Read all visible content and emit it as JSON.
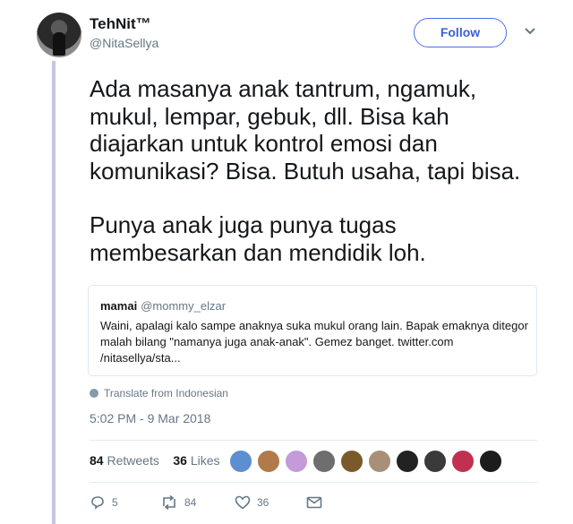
{
  "author": {
    "name": "TehNit™",
    "handle": "@NitaSellya"
  },
  "follow_label": "Follow",
  "tweet": {
    "paragraph1": "Ada masanya anak tantrum, ngamuk, mukul, lempar, gebuk, dll. Bisa kah diajarkan untuk kontrol emosi dan komunikasi? Bisa. Butuh usaha, tapi bisa.",
    "paragraph2": "Punya anak juga punya tugas membesarkan dan mendidik loh."
  },
  "quoted": {
    "name": "mamai",
    "handle": "@mommy_elzar",
    "text": "Waini, apalagi kalo sampe anaknya suka mukul orang lain. Bapak emaknya ditegor malah bilang \"namanya juga anak-anak\". Gemez banget. twitter.com /nitasellya/sta..."
  },
  "translate_label": "Translate from Indonesian",
  "timestamp": "5:02 PM - 9 Mar 2018",
  "stats": {
    "retweets": "84",
    "retweets_label": "Retweets",
    "likes": "36",
    "likes_label": "Likes"
  },
  "likers_colors": [
    "#5b8fd0",
    "#b07a4a",
    "#c59ad8",
    "#6e6e6e",
    "#7a5a2a",
    "#a89078",
    "#222222",
    "#3a3a3a",
    "#c03050",
    "#1c1c1c"
  ],
  "actions": {
    "replies": "5",
    "retweets": "84",
    "likes": "36"
  }
}
